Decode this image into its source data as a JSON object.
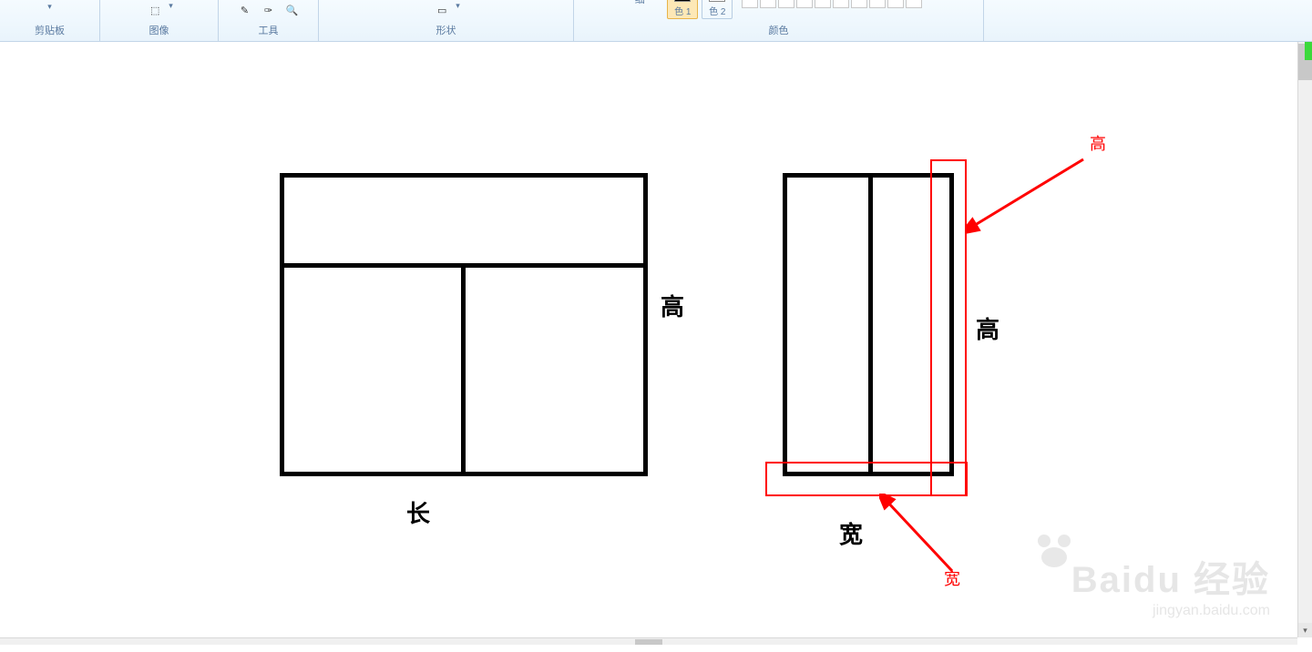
{
  "ribbon": {
    "groups": {
      "clipboard": "剪贴板",
      "image": "图像",
      "tools": "工具",
      "shapes": "形状",
      "colors": "颜色"
    },
    "size_thin": "细",
    "color1_label": "色 1",
    "color2_label": "色 2",
    "color1_hex": "#000000",
    "color2_hex": "#ffffff"
  },
  "canvas": {
    "labels": {
      "gao_black_left": "高",
      "chang": "长",
      "gao_black_right": "高",
      "kuan_black": "宽",
      "gao_red": "高",
      "kuan_red": "宽"
    }
  },
  "watermark": {
    "brand": "Baidu 经验",
    "url": "jingyan.baidu.com"
  }
}
